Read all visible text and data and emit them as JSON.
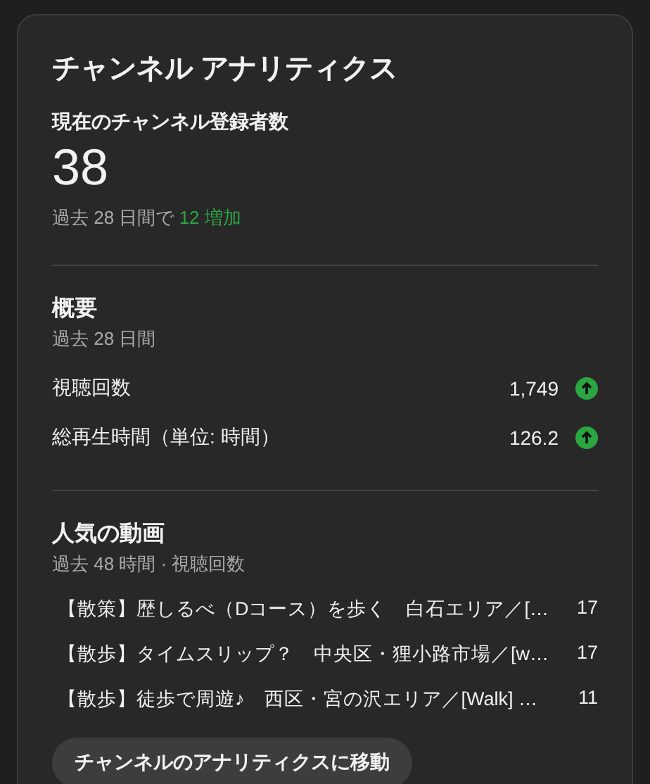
{
  "title": "チャンネル アナリティクス",
  "subscribers": {
    "label": "現在のチャンネル登録者数",
    "count": "38",
    "change_prefix": "過去 28 日間で",
    "change": "12 増加"
  },
  "summary": {
    "heading": "概要",
    "period": "過去 28 日間",
    "metrics": [
      {
        "label": "視聴回数",
        "value": "1,749",
        "increasing": true
      },
      {
        "label": "総再生時間（単位: 時間）",
        "value": "126.2",
        "increasing": true
      }
    ]
  },
  "top_videos": {
    "heading": "人気の動画",
    "period": "過去 48 時間 · 視聴回数",
    "videos": [
      {
        "title": "【散策】歴しるべ（Dコース）を歩く　白石エリア／[…",
        "views": "17"
      },
      {
        "title": "【散歩】タイムスリップ？　中央区・狸小路市場／[w…",
        "views": "17"
      },
      {
        "title": "【散歩】徒歩で周遊♪　西区・宮の沢エリア／[Walk] …",
        "views": "11"
      }
    ]
  },
  "button": "チャンネルのアナリティクスに移動"
}
